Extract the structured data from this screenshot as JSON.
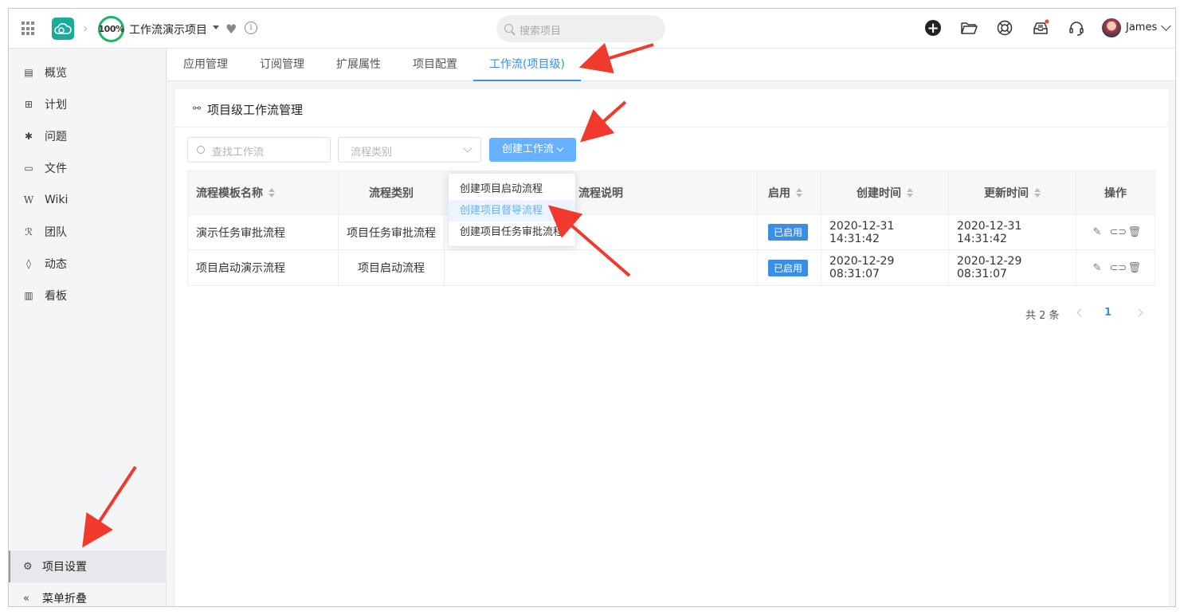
{
  "topbar": {
    "progress": "100%",
    "project_name": "工作流演示项目",
    "search_placeholder": "搜索项目",
    "user_name": "James",
    "icons": [
      "apps-grid-icon",
      "cloud-logo-icon",
      "heart-icon",
      "info-icon",
      "add-icon",
      "folder-icon",
      "help-lifebuoy-icon",
      "inbox-icon",
      "headset-icon"
    ]
  },
  "sidebar": {
    "items": [
      {
        "label": "概览",
        "icon": "overview-icon"
      },
      {
        "label": "计划",
        "icon": "plan-icon"
      },
      {
        "label": "问题",
        "icon": "bug-icon"
      },
      {
        "label": "文件",
        "icon": "folder-icon"
      },
      {
        "label": "Wiki",
        "icon": "wiki-icon"
      },
      {
        "label": "团队",
        "icon": "team-icon"
      },
      {
        "label": "动态",
        "icon": "activity-icon"
      },
      {
        "label": "看板",
        "icon": "board-icon"
      }
    ],
    "settings_label": "项目设置",
    "collapse_label": "菜单折叠"
  },
  "tabs": [
    {
      "label": "应用管理"
    },
    {
      "label": "订阅管理"
    },
    {
      "label": "扩展属性"
    },
    {
      "label": "项目配置"
    },
    {
      "label": "工作流(项目级)",
      "active": true
    }
  ],
  "main": {
    "title": "项目级工作流管理",
    "search_placeholder": "查找工作流",
    "category_placeholder": "流程类别",
    "create_button": "创建工作流",
    "dropdown": [
      "创建项目启动流程",
      "创建项目督导流程",
      "创建项目任务审批流程"
    ],
    "table": {
      "headers": [
        "流程模板名称",
        "流程类别",
        "流程说明",
        "启用",
        "创建时间",
        "更新时间",
        "操作"
      ],
      "rows": [
        {
          "name": "演示任务审批流程",
          "category": "项目任务审批流程",
          "desc": "",
          "status": "已启用",
          "created": "2020-12-31 14:31:42",
          "updated": "2020-12-31 14:31:42"
        },
        {
          "name": "项目启动演示流程",
          "category": "项目启动流程",
          "desc": "",
          "status": "已启用",
          "created": "2020-12-29 08:31:07",
          "updated": "2020-12-29 08:31:07"
        }
      ]
    },
    "pager": {
      "total": "共 2 条",
      "current": "1"
    }
  },
  "colors": {
    "accent": "#3a8ee6",
    "button": "#66b1ff",
    "logo": "#1aab9b",
    "progress": "#19b561",
    "annotation_arrow": "#f03a2e"
  }
}
